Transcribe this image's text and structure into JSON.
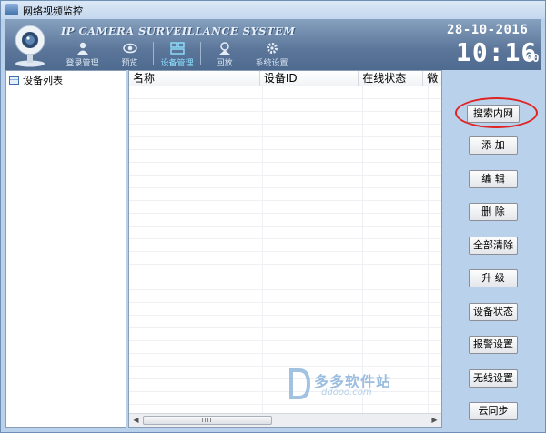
{
  "window": {
    "title": "网络视频监控"
  },
  "banner": {
    "brand": "IP CAMERA SURVEILLANCE SYSTEM",
    "menu": [
      {
        "label": "登录管理",
        "icon": "user-icon"
      },
      {
        "label": "预览",
        "icon": "eye-icon"
      },
      {
        "label": "设备管理",
        "icon": "device-grid-icon",
        "active": true
      },
      {
        "label": "回放",
        "icon": "playback-icon"
      },
      {
        "label": "系统设置",
        "icon": "gear-icon"
      }
    ],
    "clock": {
      "date": "28-10-2016",
      "time": "10:16",
      "seconds": "00"
    }
  },
  "tree": {
    "root_label": "设备列表"
  },
  "device_table": {
    "columns": [
      "名称",
      "设备ID",
      "在线状态",
      "微"
    ],
    "rows": []
  },
  "watermark": {
    "text": "多多软件站",
    "sub": "ddooo.com"
  },
  "actions": {
    "search_lan": "搜索内网",
    "add": "添 加",
    "edit": "编 辑",
    "delete": "删 除",
    "clear_all": "全部清除",
    "upgrade": "升 级",
    "device_status": "设备状态",
    "alarm_settings": "报警设置",
    "wireless_settings": "无线设置",
    "cloud_sync": "云同步"
  },
  "colors": {
    "banner": "#5b7699",
    "highlight_ring": "#e02424",
    "accent": "#8fe0ff"
  }
}
